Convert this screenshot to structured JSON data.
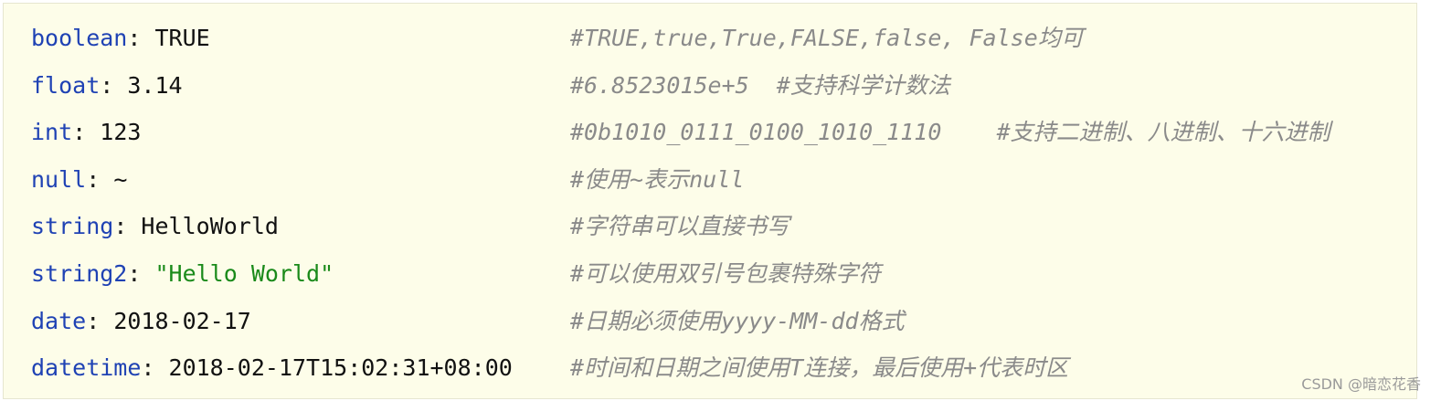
{
  "lines": [
    {
      "key": "boolean",
      "sep": ": ",
      "value": "TRUE",
      "comment": "#TRUE,true,True,FALSE,false, False均可"
    },
    {
      "key": "float",
      "sep": ": ",
      "value": "3.14",
      "comment": "#6.8523015e+5  #支持科学计数法"
    },
    {
      "key": "int",
      "sep": ": ",
      "value": "123",
      "comment": "#0b1010_0111_0100_1010_1110    #支持二进制、八进制、十六进制"
    },
    {
      "key": "null",
      "sep": ": ",
      "value": "~",
      "comment": "#使用~表示null"
    },
    {
      "key": "string",
      "sep": ": ",
      "value": "HelloWorld",
      "comment": "#字符串可以直接书写"
    },
    {
      "key": "string2",
      "sep": ": ",
      "value": "\"Hello World\"",
      "comment": "#可以使用双引号包裹特殊字符"
    },
    {
      "key": "date",
      "sep": ": ",
      "value": "2018-02-17",
      "comment": "#日期必须使用yyyy-MM-dd格式"
    },
    {
      "key": "datetime",
      "sep": ": ",
      "value": "2018-02-17T15:02:31+08:00",
      "comment": "#时间和日期之间使用T连接，最后使用+代表时区"
    }
  ],
  "watermark": "CSDN @暗恋花香"
}
